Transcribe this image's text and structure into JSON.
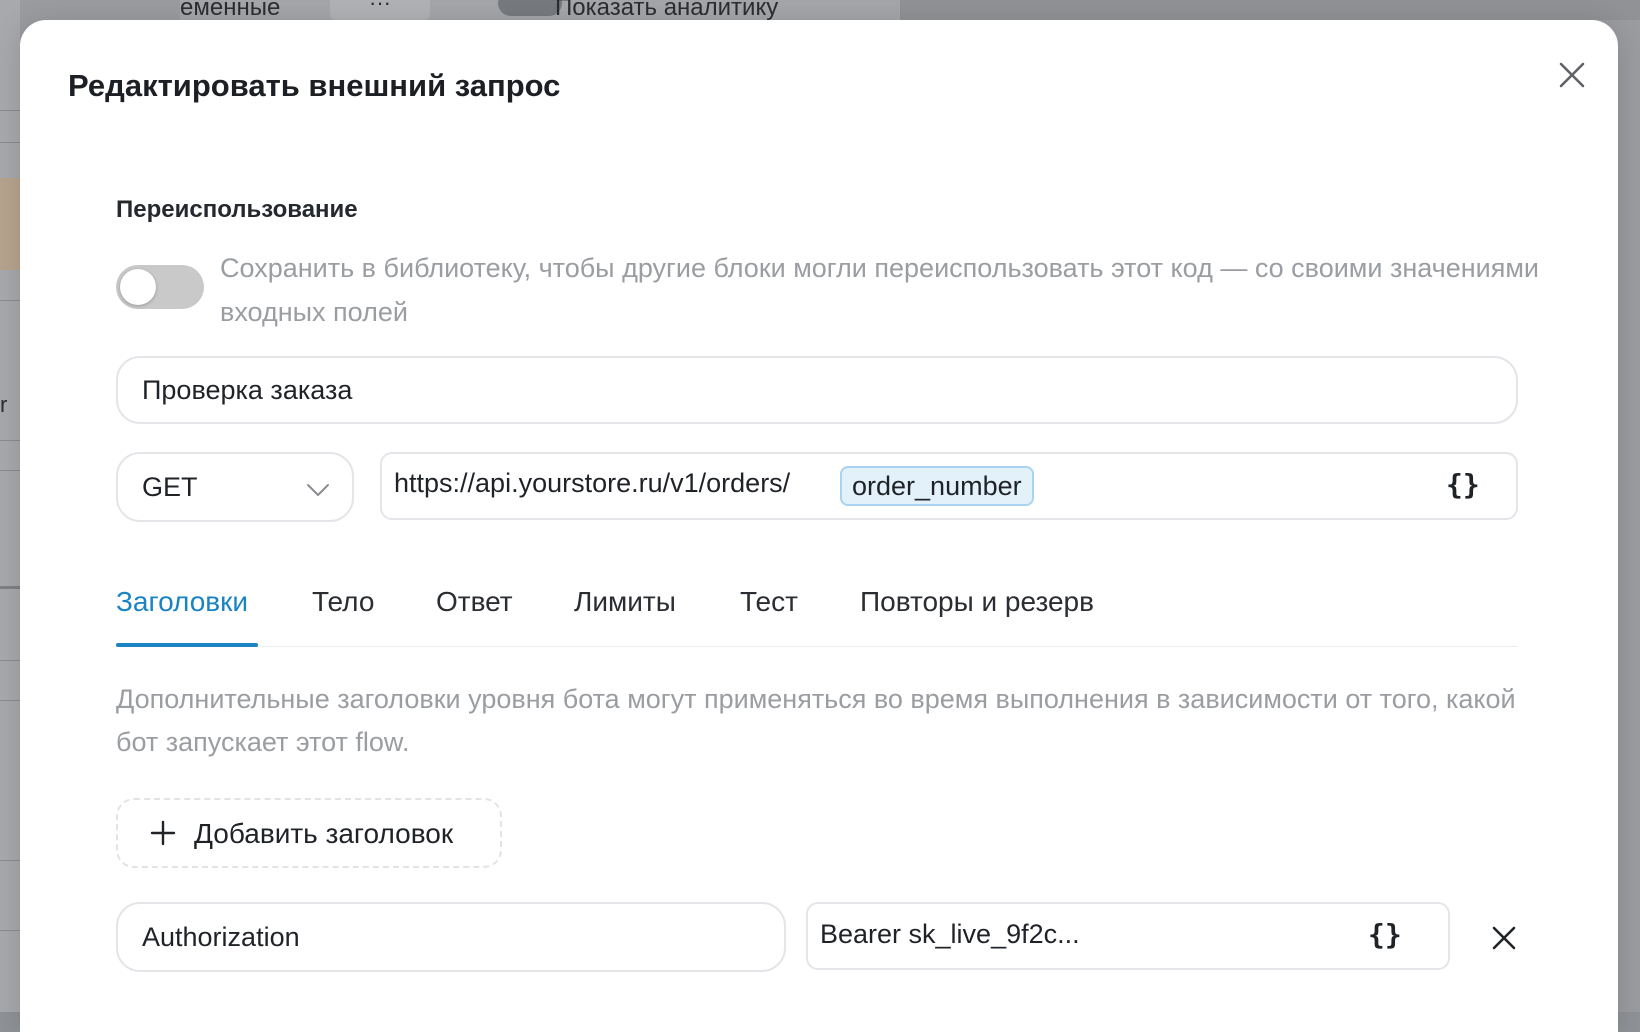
{
  "background": {
    "variables_label": "еменные",
    "more_label": "···",
    "analytics_label": "Показать аналитику",
    "side_char": "r"
  },
  "modal": {
    "title": "Редактировать внешний запрос",
    "close_icon": "close-icon"
  },
  "reuse": {
    "label": "Переиспользование",
    "enabled": false,
    "description": "Сохранить в библиотеку, чтобы другие блоки могли переиспользовать этот код — со своими значениями входных полей"
  },
  "request": {
    "name": "Проверка заказа",
    "method": "GET",
    "url_prefix": "https://api.yourstore.ru/v1/orders/",
    "url_variable": "order_number",
    "variable_button": "{}"
  },
  "tabs": [
    {
      "label": "Заголовки",
      "active": true
    },
    {
      "label": "Тело",
      "active": false
    },
    {
      "label": "Ответ",
      "active": false
    },
    {
      "label": "Лимиты",
      "active": false
    },
    {
      "label": "Тест",
      "active": false
    },
    {
      "label": "Повторы и резерв",
      "active": false
    }
  ],
  "headers_panel": {
    "help_text": "Дополнительные заголовки уровня бота могут применяться во время выполнения в зависимости от того, какой бот запускает этот flow.",
    "add_button": "Добавить заголовок",
    "rows": [
      {
        "key": "Authorization",
        "value": "Bearer sk_live_9f2c...",
        "variable_button": "{}"
      }
    ]
  },
  "colors": {
    "accent": "#1a84c3",
    "chip_bg": "#e3f1fb",
    "chip_border": "#a9d3ef",
    "muted_text": "#9a9da1"
  }
}
